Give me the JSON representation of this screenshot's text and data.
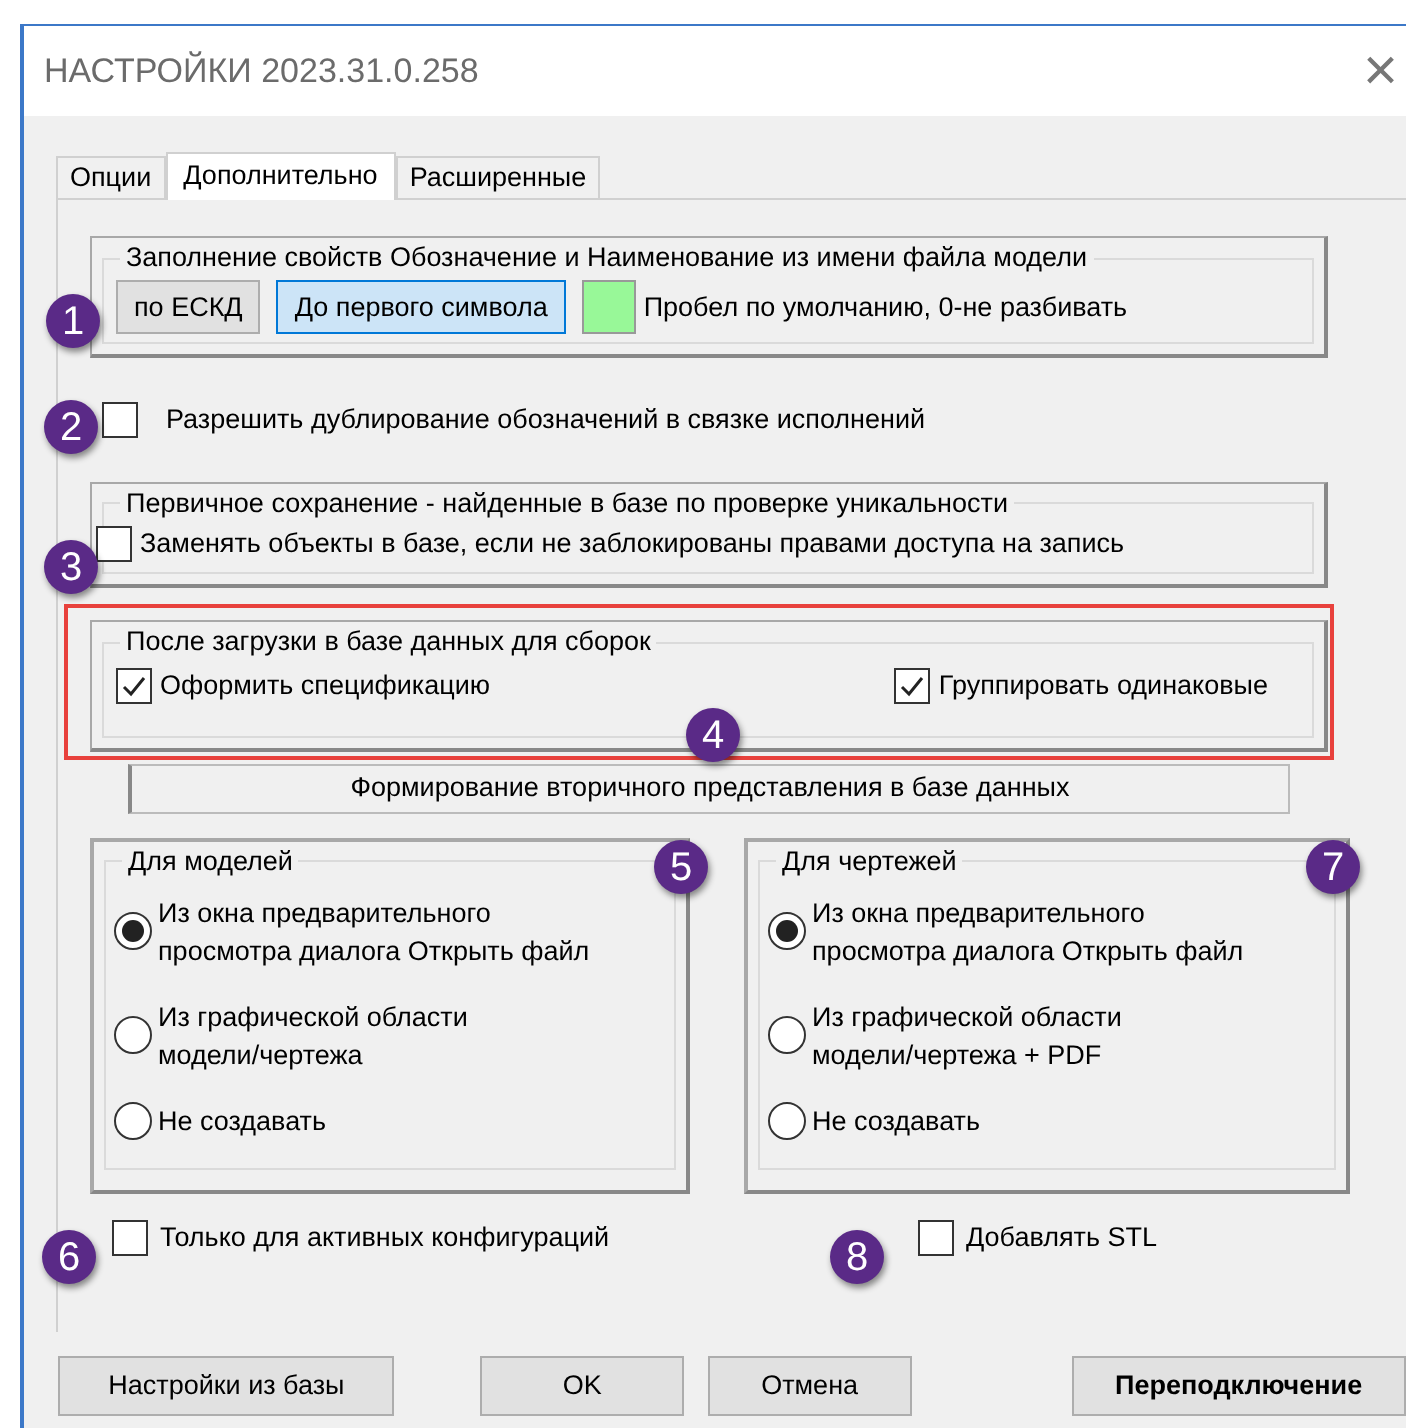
{
  "window": {
    "title": "НАСТРОЙКИ 2023.31.0.258",
    "close": "×"
  },
  "tabs": [
    {
      "label": "Опции",
      "selected": false
    },
    {
      "label": "Дополнительно",
      "selected": true
    },
    {
      "label": "Расширенные",
      "selected": false
    }
  ],
  "naming_group": {
    "legend": "Заполнение  свойств Обозначение и Наименование  из имени файла модели",
    "buttons": [
      {
        "label": "по ЕСКД",
        "selected": false
      },
      {
        "label": "До первого символа",
        "selected": true
      }
    ],
    "hint": "Пробел по умолчанию, 0-не разбивать"
  },
  "allow_duplicates": {
    "label": "Разрешить дублирование обозначений  в связке исполнений",
    "checked": false
  },
  "primary_save_group": {
    "legend": "Первичное сохранение - найденные в базе по проверке уникальности",
    "checkbox": {
      "label": "Заменять объекты в базе, если не заблокированы правами доступа на запись",
      "checked": false
    }
  },
  "assembly_group": {
    "legend": "После загрузки в базе данных для сборок",
    "checkboxes": [
      {
        "label": "Оформить спецификацию",
        "checked": true
      },
      {
        "label": "Группировать одинаковые",
        "checked": true
      }
    ]
  },
  "secondary_header": "Формирование вторичного представления  в базе данных",
  "models_group": {
    "legend": "Для моделей",
    "options": [
      {
        "label": "Из окна предварительного просмотра диалога Открыть файл",
        "selected": true
      },
      {
        "label": "Из графической области модели/чертежа",
        "selected": false
      },
      {
        "label": "Не создавать",
        "selected": false
      }
    ]
  },
  "drawings_group": {
    "legend": "Для чертежей",
    "options": [
      {
        "label": "Из окна предварительного просмотра диалога Открыть файл",
        "selected": true
      },
      {
        "label": "Из графической области модели/чертежа + PDF",
        "selected": false
      },
      {
        "label": "Не создавать",
        "selected": false
      }
    ]
  },
  "active_configs_only": {
    "label": "Только для активных конфигураций",
    "checked": false
  },
  "add_stl": {
    "label": "Добавлять STL",
    "checked": false
  },
  "buttons": [
    {
      "label": "Настройки из базы",
      "kind": "normal"
    },
    {
      "label": "OK",
      "kind": "normal"
    },
    {
      "label": "Отмена",
      "kind": "normal"
    },
    {
      "label": "Переподключение",
      "kind": "bold"
    }
  ],
  "annotations": [
    {
      "label": "1"
    },
    {
      "label": "2"
    },
    {
      "label": "3"
    },
    {
      "label": "4"
    },
    {
      "label": "5"
    },
    {
      "label": "6"
    },
    {
      "label": "7"
    },
    {
      "label": "8"
    }
  ]
}
